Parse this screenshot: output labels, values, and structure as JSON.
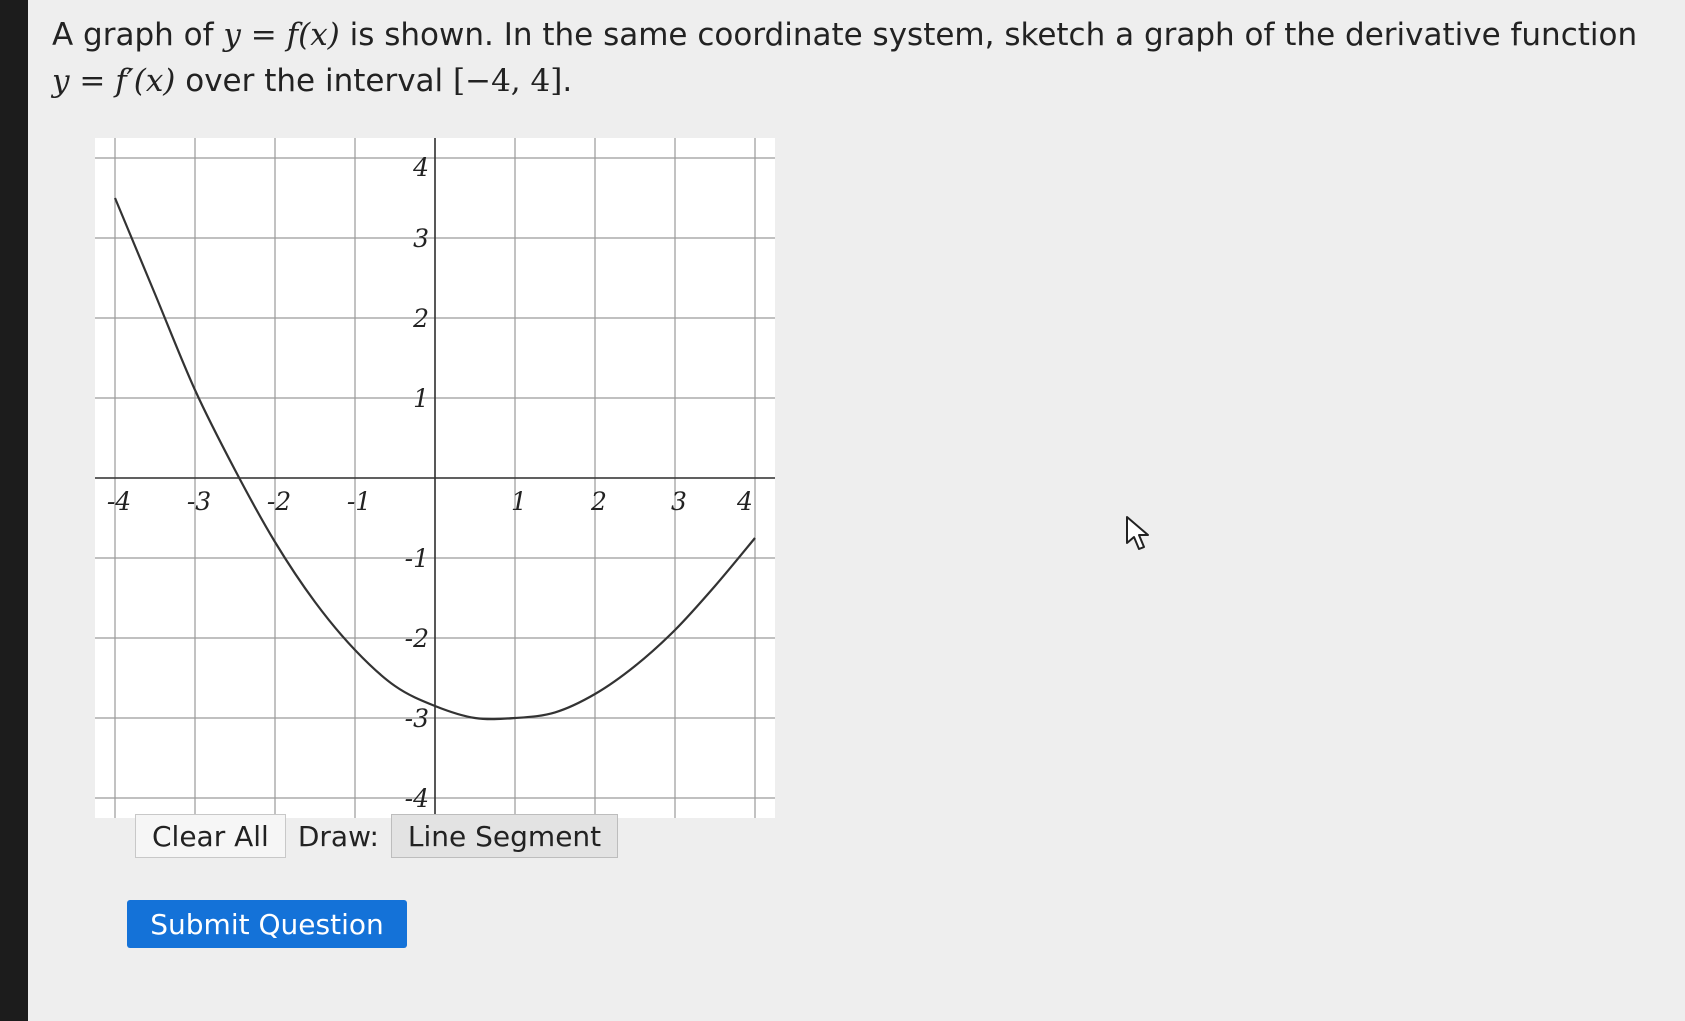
{
  "question": {
    "p1": "A graph of ",
    "m_y1": "y",
    "m_eq1": " = ",
    "m_fx": "f",
    "m_x1": "(x)",
    "p2": " is shown. In the same coordinate system, sketch a graph of the derivative function ",
    "m_y2": "y",
    "m_eq2": " = ",
    "m_fpx": "f′",
    "m_x2": "(x)",
    "p3": " over the interval ",
    "interval": "[−4, 4]",
    "p4": "."
  },
  "graph": {
    "x_ticks": [
      "-4",
      "-3",
      "-2",
      "-1",
      "1",
      "2",
      "3",
      "4"
    ],
    "y_ticks": [
      "4",
      "3",
      "2",
      "1",
      "-1",
      "-2",
      "-3",
      "-4"
    ],
    "xlim": [
      -4,
      4
    ],
    "ylim": [
      -4,
      4
    ],
    "curve_color": "#333333",
    "grid_color": "#9a9a9a"
  },
  "chart_data": {
    "type": "line",
    "x": [
      -4,
      -3.5,
      -3,
      -2.5,
      -2,
      -1.5,
      -1,
      -0.5,
      0,
      0.5,
      1,
      1.5,
      2,
      2.5,
      3,
      3.5,
      4
    ],
    "y": [
      3.5,
      2.3,
      1.1,
      0.1,
      -0.8,
      -1.55,
      -2.15,
      -2.6,
      -2.85,
      -3.0,
      -3.0,
      -2.93,
      -2.7,
      -2.35,
      -1.9,
      -1.35,
      -0.75
    ],
    "xlim": [
      -4,
      4
    ],
    "ylim": [
      -4,
      4
    ],
    "grid": true
  },
  "toolbar": {
    "clear_all": "Clear All",
    "draw_label": "Draw:",
    "line_segment": "Line Segment"
  },
  "submit_label": "Submit Question"
}
